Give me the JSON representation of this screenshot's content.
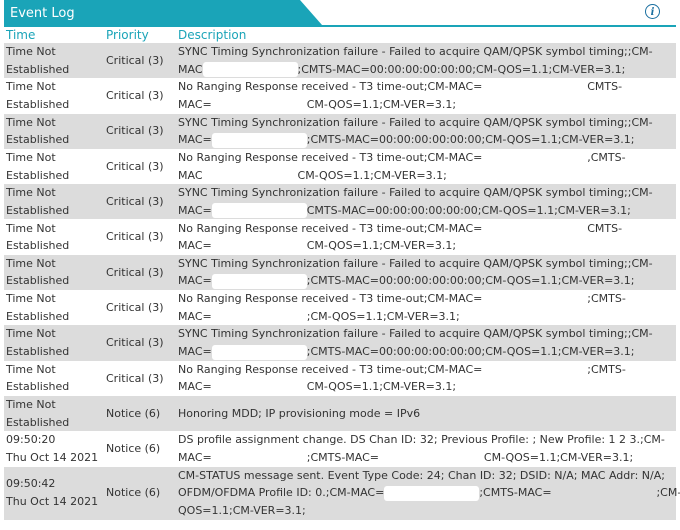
{
  "panel": {
    "title": "Event Log",
    "info_icon": "info-icon"
  },
  "columns": {
    "time": "Time",
    "priority": "Priority",
    "description": "Description"
  },
  "rows": [
    {
      "time_line1": "Time Not",
      "time_line2": "Established",
      "priority": "Critical (3)",
      "desc_line1": "SYNC Timing Synchronization failure - Failed to acquire QAM/QPSK symbol timing;;CM-",
      "desc_line2_a": "MAC",
      "desc_line2_b": ";CMTS-MAC=00:00:00:00:00:00;CM-QOS=1.1;CM-VER=3.1;"
    },
    {
      "time_line1": "Time Not",
      "time_line2": "Established",
      "priority": "Critical (3)",
      "desc_line1": "No Ranging Response received - T3 time-out;CM-MAC=                              CMTS-",
      "desc_line2_a": "MAC=",
      "desc_line2_b": "CM-QOS=1.1;CM-VER=3.1;"
    },
    {
      "time_line1": "Time Not",
      "time_line2": "Established",
      "priority": "Critical (3)",
      "desc_line1": "SYNC Timing Synchronization failure - Failed to acquire QAM/QPSK symbol timing;;CM-",
      "desc_line2_a": "MAC=",
      "desc_line2_b": ";CMTS-MAC=00:00:00:00:00:00;CM-QOS=1.1;CM-VER=3.1;"
    },
    {
      "time_line1": "Time Not",
      "time_line2": "Established",
      "priority": "Critical (3)",
      "desc_line1": "No Ranging Response received - T3 time-out;CM-MAC=                              ,CMTS-",
      "desc_line2_a": "MAC",
      "desc_line2_b": "CM-QOS=1.1;CM-VER=3.1;"
    },
    {
      "time_line1": "Time Not",
      "time_line2": "Established",
      "priority": "Critical (3)",
      "desc_line1": "SYNC Timing Synchronization failure - Failed to acquire QAM/QPSK symbol timing;;CM-",
      "desc_line2_a": "MAC=",
      "desc_line2_b": "CMTS-MAC=00:00:00:00:00:00;CM-QOS=1.1;CM-VER=3.1;"
    },
    {
      "time_line1": "Time Not",
      "time_line2": "Established",
      "priority": "Critical (3)",
      "desc_line1": "No Ranging Response received - T3 time-out;CM-MAC=                              CMTS-",
      "desc_line2_a": "MAC=",
      "desc_line2_b": "CM-QOS=1.1;CM-VER=3.1;"
    },
    {
      "time_line1": "Time Not",
      "time_line2": "Established",
      "priority": "Critical (3)",
      "desc_line1": "SYNC Timing Synchronization failure - Failed to acquire QAM/QPSK symbol timing;;CM-",
      "desc_line2_a": "MAC=",
      "desc_line2_b": ";CMTS-MAC=00:00:00:00:00:00;CM-QOS=1.1;CM-VER=3.1;"
    },
    {
      "time_line1": "Time Not",
      "time_line2": "Established",
      "priority": "Critical (3)",
      "desc_line1": "No Ranging Response received - T3 time-out;CM-MAC=                              ;CMTS-",
      "desc_line2_a": "MAC=",
      "desc_line2_b": ";CM-QOS=1.1;CM-VER=3.1;"
    },
    {
      "time_line1": "Time Not",
      "time_line2": "Established",
      "priority": "Critical (3)",
      "desc_line1": "SYNC Timing Synchronization failure - Failed to acquire QAM/QPSK symbol timing;;CM-",
      "desc_line2_a": "MAC=",
      "desc_line2_b": ";CMTS-MAC=00:00:00:00:00:00;CM-QOS=1.1;CM-VER=3.1;"
    },
    {
      "time_line1": "Time Not",
      "time_line2": "Established",
      "priority": "Critical (3)",
      "desc_line1": "No Ranging Response received - T3 time-out;CM-MAC=                              ;CMTS-",
      "desc_line2_a": "MAC=",
      "desc_line2_b": "CM-QOS=1.1;CM-VER=3.1;"
    },
    {
      "time_line1": "Time Not",
      "time_line2": "Established",
      "priority": "Notice (6)",
      "desc_line1": "Honoring MDD; IP provisioning mode = IPv6"
    },
    {
      "time_line1": "09:50:20",
      "time_line2": "Thu Oct 14 2021",
      "priority": "Notice (6)",
      "desc_line1": "DS profile assignment change. DS Chan ID: 32; Previous Profile: ; New Profile: 1 2 3.;CM-",
      "desc_line2_a": "MAC=",
      "desc_line2_b": ";CMTS-MAC=                              CM-QOS=1.1;CM-VER=3.1;"
    },
    {
      "time_line1": "09:50:42",
      "time_line2": "Thu Oct 14 2021",
      "priority": "Notice (6)",
      "desc_line1": "CM-STATUS message sent. Event Type Code: 24; Chan ID: 32; DSID: N/A; MAC Addr: N/A;",
      "desc_line2_a": "OFDM/OFDMA Profile ID: 0.;CM-MAC=",
      "desc_line2_b": ";CMTS-MAC=                              ;CM-",
      "desc_line3": "QOS=1.1;CM-VER=3.1;"
    }
  ]
}
